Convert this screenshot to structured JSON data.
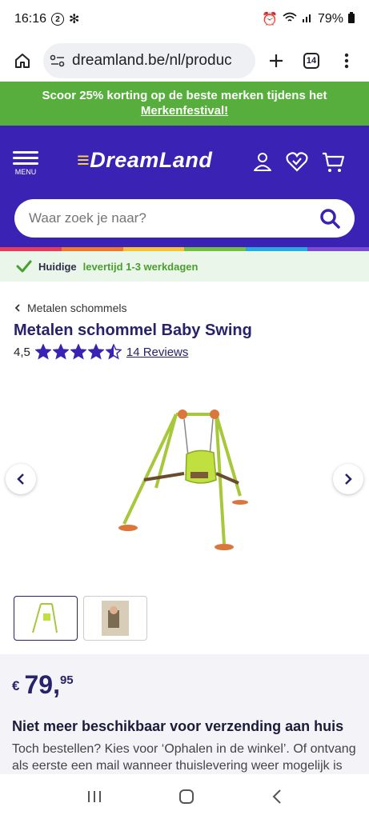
{
  "status": {
    "time": "16:16",
    "badge": "2",
    "battery": "79%"
  },
  "browser": {
    "url": "dreamland.be/nl/produc",
    "tab_count": "14"
  },
  "promo": {
    "line1": "Scoor 25% korting op de beste merken tijdens het",
    "link": "Merkenfestival!"
  },
  "header": {
    "menu_label": "MENU",
    "logo": "DreamLand"
  },
  "search": {
    "placeholder": "Waar zoek je naar?"
  },
  "rainbow_colors": [
    "#e63b5a",
    "#f07a2a",
    "#f7c233",
    "#73c040",
    "#2aa8e0",
    "#7a4bd1"
  ],
  "delivery": {
    "prefix": "Huidige",
    "highlight": "levertijd 1-3 werkdagen"
  },
  "breadcrumb": {
    "label": "Metalen schommels"
  },
  "product": {
    "title": "Metalen schommel Baby Swing",
    "rating": "4,5",
    "stars": 4.5,
    "reviews": "14 Reviews"
  },
  "price": {
    "currency": "€",
    "main": "79,",
    "cents": "95"
  },
  "availability": {
    "heading": "Niet meer beschikbaar voor verzending aan huis",
    "text": "Toch bestellen? Kies voor ‘Ophalen in de winkel’. Of ontvang als eerste een mail wanneer thuislevering weer mogelijk is"
  },
  "colors": {
    "brand": "#3a22b4",
    "promo": "#57ae3c",
    "title": "#27226a"
  }
}
